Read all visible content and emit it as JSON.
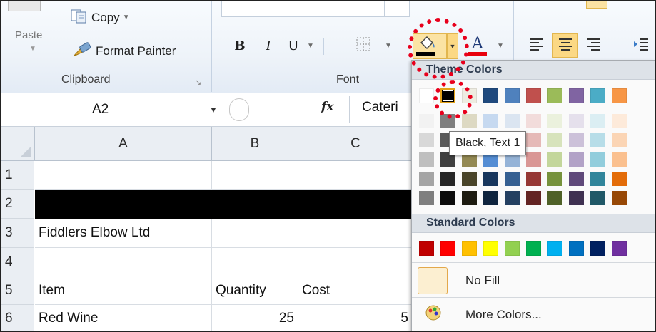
{
  "ribbon": {
    "clipboard": {
      "paste_label": "Paste",
      "copy_label": "Copy",
      "format_painter_label": "Format Painter",
      "group_label": "Clipboard"
    },
    "font": {
      "bold_label": "B",
      "italic_label": "I",
      "underline_label": "U",
      "font_color_label": "A",
      "group_label": "Font",
      "fill_color": "#000000",
      "font_color": "#e8000c"
    }
  },
  "formula_bar": {
    "name_box": "A2",
    "fx_label": "fx",
    "value": "Cateri"
  },
  "sheet": {
    "columns": [
      "A",
      "B",
      "C"
    ],
    "rows": [
      {
        "num": "1",
        "a": "",
        "b": "",
        "c": ""
      },
      {
        "num": "2",
        "a": "",
        "b": "",
        "c": ""
      },
      {
        "num": "3",
        "a": "Fiddlers Elbow Ltd",
        "b": "",
        "c": ""
      },
      {
        "num": "4",
        "a": "",
        "b": "",
        "c": ""
      },
      {
        "num": "5",
        "a": "Item",
        "b": "Quantity",
        "c": "Cost"
      },
      {
        "num": "6",
        "a": "Red Wine",
        "b": "25",
        "c": "5"
      }
    ],
    "fill_row_color": "#000000"
  },
  "palette": {
    "theme_header": "Theme Colors",
    "standard_header": "Standard Colors",
    "no_fill_label": "No Fill",
    "more_colors_label": "More Colors...",
    "tooltip": "Black, Text 1",
    "theme_colors": [
      "#ffffff",
      "#000000",
      "#eeece1",
      "#1f497d",
      "#4f81bd",
      "#c0504d",
      "#9bbb59",
      "#8064a2",
      "#4bacc6",
      "#f79646"
    ],
    "theme_shades": [
      [
        "#f2f2f2",
        "#d8d8d8",
        "#bfbfbf",
        "#a5a5a5",
        "#7f7f7f"
      ],
      [
        "#7f7f7f",
        "#595959",
        "#3f3f3f",
        "#262626",
        "#0c0c0c"
      ],
      [
        "#ddd9c3",
        "#c4bd97",
        "#938953",
        "#494429",
        "#1d1b10"
      ],
      [
        "#c6d9f0",
        "#8db3e2",
        "#548dd4",
        "#17365d",
        "#0f243e"
      ],
      [
        "#dbe5f1",
        "#b8cce4",
        "#95b3d7",
        "#366092",
        "#244061"
      ],
      [
        "#f2dcdb",
        "#e5b9b7",
        "#d99694",
        "#953734",
        "#632423"
      ],
      [
        "#ebf1dd",
        "#d7e3bc",
        "#c3d69b",
        "#76923c",
        "#4f6128"
      ],
      [
        "#e5e0ec",
        "#ccc1d9",
        "#b2a2c7",
        "#5f497a",
        "#3f3151"
      ],
      [
        "#dbeef3",
        "#b7dde8",
        "#92cddc",
        "#31859b",
        "#205867"
      ],
      [
        "#fdeada",
        "#fbd5b5",
        "#fac08f",
        "#e36c09",
        "#974806"
      ]
    ],
    "standard_colors": [
      "#c00000",
      "#ff0000",
      "#ffc000",
      "#ffff00",
      "#92d050",
      "#00b050",
      "#00b0f0",
      "#0070c0",
      "#002060",
      "#7030a0"
    ]
  }
}
